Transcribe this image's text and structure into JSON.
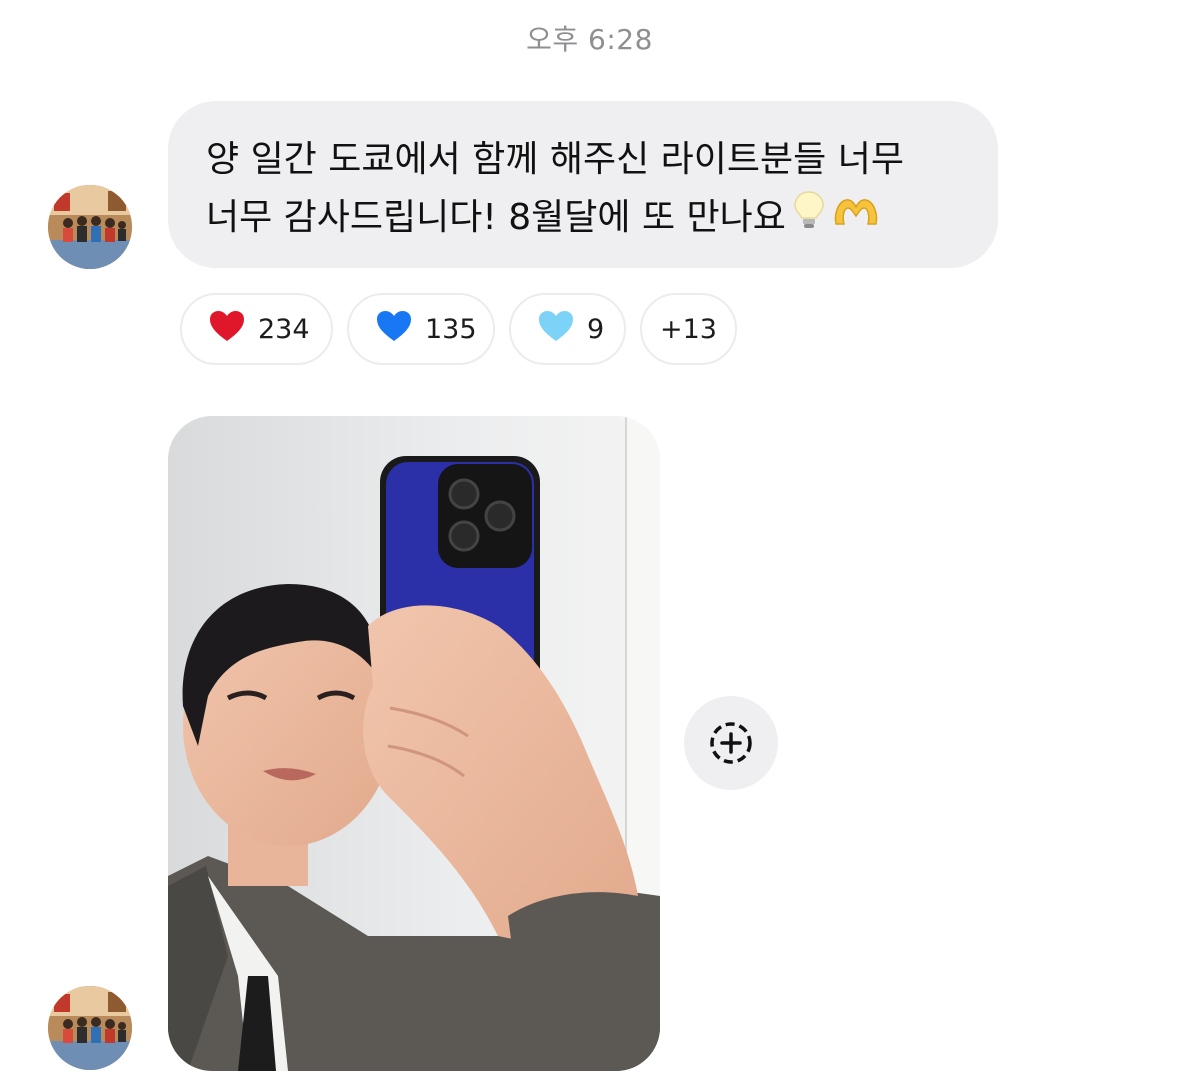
{
  "timestamp": "오후 6:28",
  "message": {
    "text": "양 일간 도쿄에서 함께 해주신 라이트분들 너무\n너무 감사드립니다! 8월달에 또 만나요",
    "emojis": [
      "lightbulb-emoji",
      "heart-hands-emoji"
    ]
  },
  "reactions": [
    {
      "icon": "red-heart-emoji",
      "color": "#e0162b",
      "count": "234"
    },
    {
      "icon": "blue-heart-emoji",
      "color": "#1877f2",
      "count": "135"
    },
    {
      "icon": "light-blue-heart-emoji",
      "color": "#7dd3f7",
      "count": "9"
    },
    {
      "icon": null,
      "count": "+13"
    }
  ],
  "photo": {
    "description_icon": "mirror-selfie-photo",
    "phone_case_color": "#2b2fa8"
  },
  "add_reaction_icon": "add-reaction-icon",
  "colors": {
    "bubble": "#efeff2",
    "timestamp": "#8e8e93",
    "reaction_border": "#ececee"
  }
}
